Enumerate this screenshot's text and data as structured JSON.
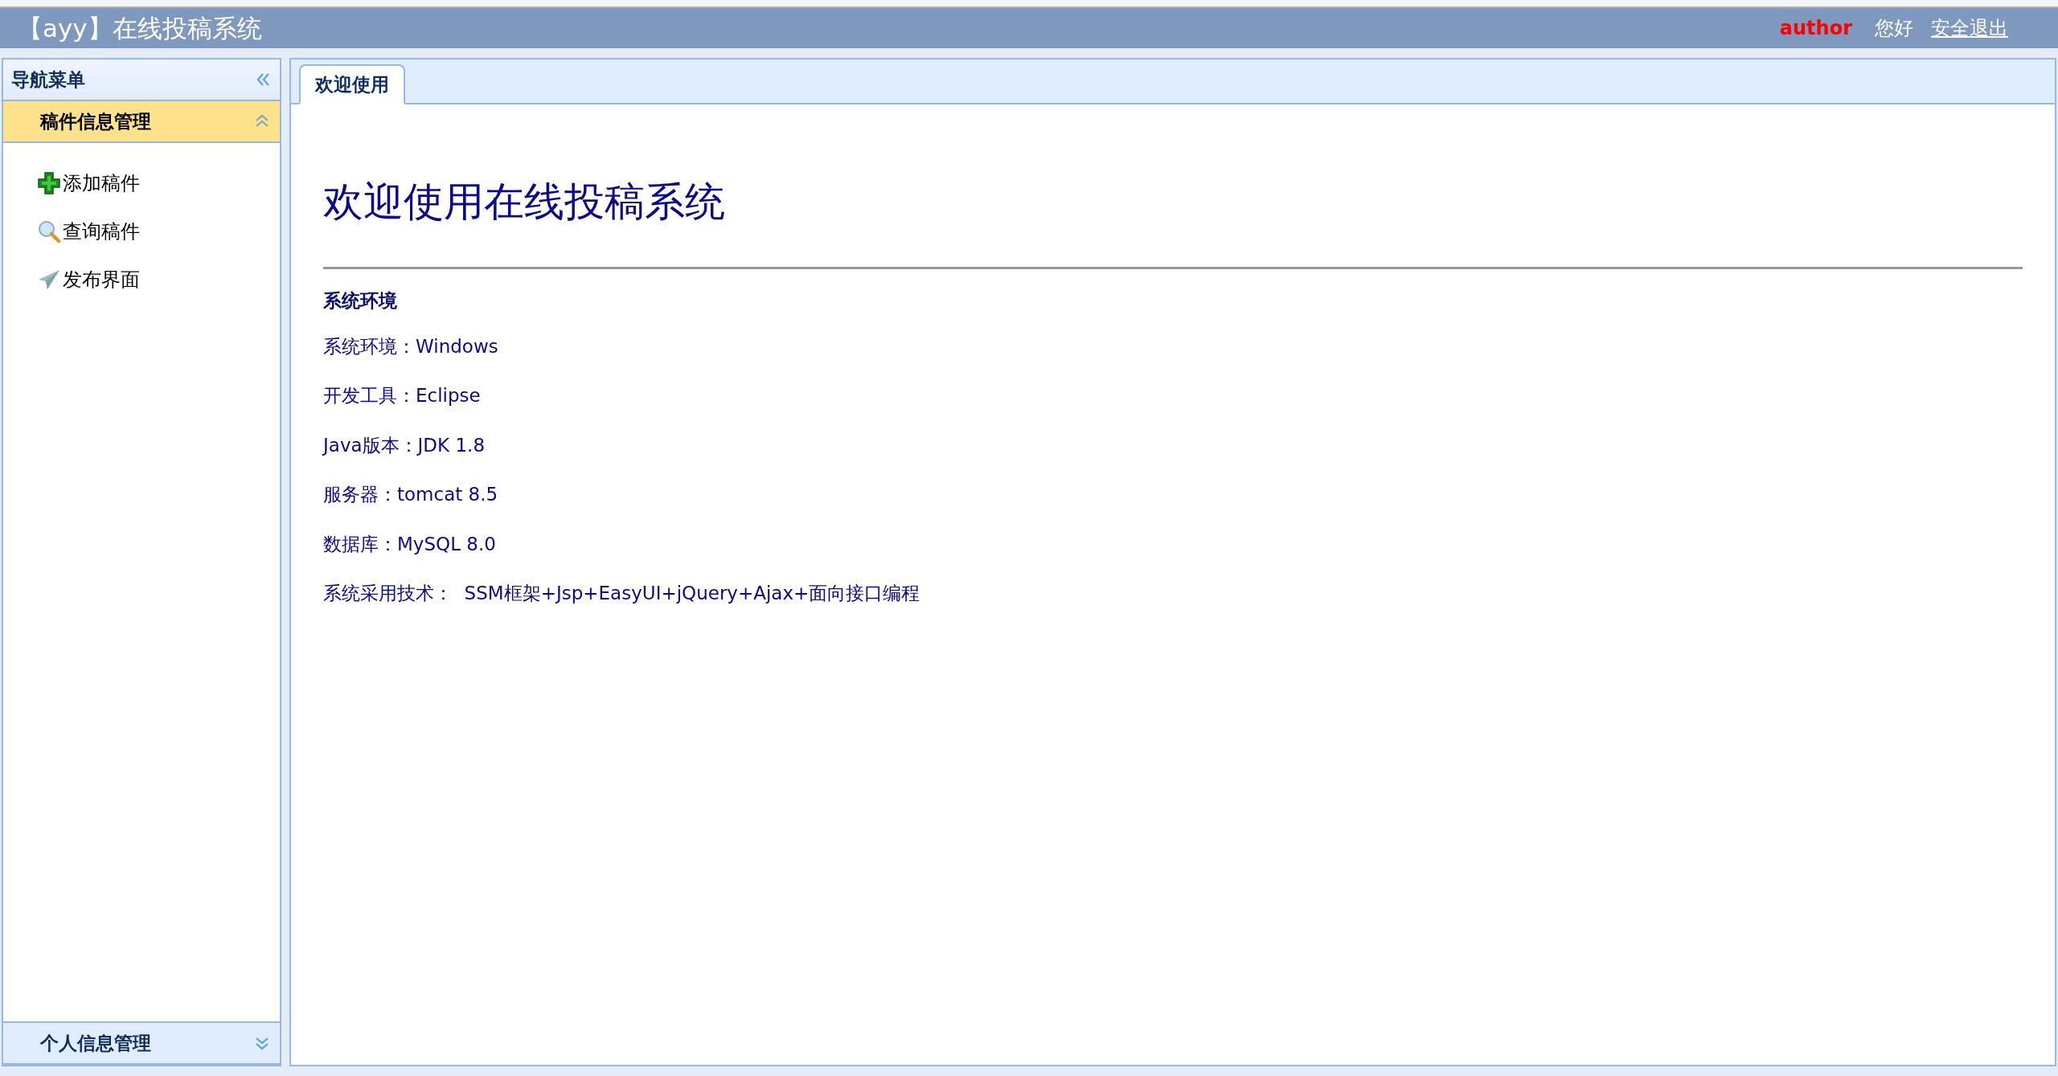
{
  "header": {
    "title": "【ayy】在线投稿系统",
    "user": "author",
    "greeting": "您好",
    "logout": "安全退出"
  },
  "sidebar": {
    "title": "导航菜单",
    "panels": [
      {
        "title": "稿件信息管理",
        "expanded": true,
        "items": [
          {
            "label": "添加稿件",
            "kind": "add"
          },
          {
            "label": "查询稿件",
            "kind": "search"
          },
          {
            "label": "发布界面",
            "kind": "publish"
          }
        ]
      },
      {
        "title": "个人信息管理",
        "expanded": false
      }
    ]
  },
  "tabs": [
    {
      "label": "欢迎使用",
      "selected": true
    }
  ],
  "content": {
    "heading": "欢迎使用在线投稿系统",
    "section_title": "系统环境",
    "lines": [
      "系统环境：Windows",
      "开发工具：Eclipse",
      "Java版本：JDK 1.8",
      "服务器：tomcat 8.5",
      "数据库：MySQL 8.0",
      "系统采用技术：  SSM框架+Jsp+EasyUI+jQuery+Ajax+面向接口编程"
    ]
  }
}
